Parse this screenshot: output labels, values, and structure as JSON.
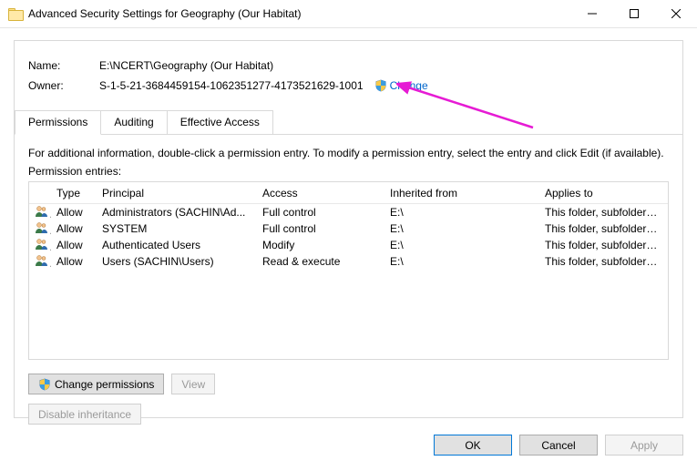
{
  "window": {
    "title": "Advanced Security Settings for Geography (Our Habitat)"
  },
  "props": {
    "name_label": "Name:",
    "name_value": "E:\\NCERT\\Geography (Our Habitat)",
    "owner_label": "Owner:",
    "owner_value": "S-1-5-21-3684459154-1062351277-4173521629-1001",
    "change_link": "Change"
  },
  "tabs": {
    "permissions": "Permissions",
    "auditing": "Auditing",
    "effective": "Effective Access"
  },
  "instruction": "For additional information, double-click a permission entry. To modify a permission entry, select the entry and click Edit (if available).",
  "section_label": "Permission entries:",
  "columns": {
    "type": "Type",
    "principal": "Principal",
    "access": "Access",
    "inherited": "Inherited from",
    "applies": "Applies to"
  },
  "rows": [
    {
      "type": "Allow",
      "principal": "Administrators (SACHIN\\Ad...",
      "access": "Full control",
      "inherited": "E:\\",
      "applies": "This folder, subfolders and files"
    },
    {
      "type": "Allow",
      "principal": "SYSTEM",
      "access": "Full control",
      "inherited": "E:\\",
      "applies": "This folder, subfolders and files"
    },
    {
      "type": "Allow",
      "principal": "Authenticated Users",
      "access": "Modify",
      "inherited": "E:\\",
      "applies": "This folder, subfolders and files"
    },
    {
      "type": "Allow",
      "principal": "Users (SACHIN\\Users)",
      "access": "Read & execute",
      "inherited": "E:\\",
      "applies": "This folder, subfolders and files"
    }
  ],
  "buttons": {
    "change_perms": "Change permissions",
    "view": "View",
    "disable_inh": "Disable inheritance",
    "ok": "OK",
    "cancel": "Cancel",
    "apply": "Apply"
  }
}
